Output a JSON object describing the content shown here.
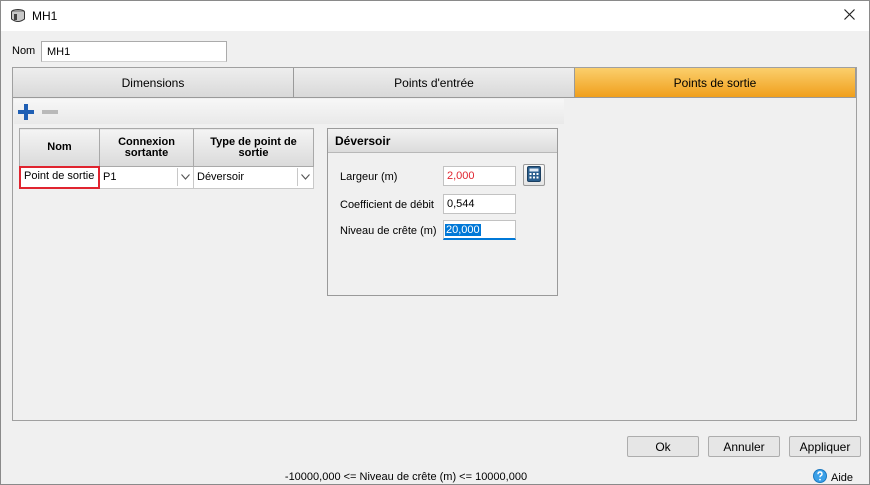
{
  "window": {
    "title": "MH1",
    "icon": "manhole-icon",
    "close_icon": "close-icon"
  },
  "nom": {
    "label": "Nom",
    "value": "MH1"
  },
  "tabs": [
    {
      "label": "Dimensions",
      "active": false
    },
    {
      "label": "Points d'entrée",
      "active": false
    },
    {
      "label": "Points de sortie",
      "active": true
    }
  ],
  "toolbar": {
    "add_icon": "plus-icon",
    "remove_icon": "minus-icon"
  },
  "grid": {
    "columns": [
      "Nom",
      "Connexion sortante",
      "Type de point de sortie"
    ],
    "rows": [
      {
        "nom": "Point de sortie",
        "connexion": "P1",
        "type": "Déversoir"
      }
    ]
  },
  "deversoir": {
    "title": "Déversoir",
    "fields": [
      {
        "label": "Largeur (m)",
        "value": "2,000",
        "color": "#e0242f"
      },
      {
        "label": "Coefficient de débit",
        "value": "0,544"
      },
      {
        "label": "Niveau de crête (m)",
        "value": "20,000"
      }
    ],
    "calc_icon": "calculator-icon"
  },
  "buttons": {
    "ok": "Ok",
    "annuler": "Annuler",
    "appliquer": "Appliquer"
  },
  "status": "-10000,000 <= Niveau de crête (m) <= 10000,000",
  "help": {
    "label": "Aide",
    "icon": "help-icon"
  },
  "colors": {
    "active_tab": "#f5b131",
    "selection": "#0078d7",
    "error_text": "#e0242f"
  }
}
